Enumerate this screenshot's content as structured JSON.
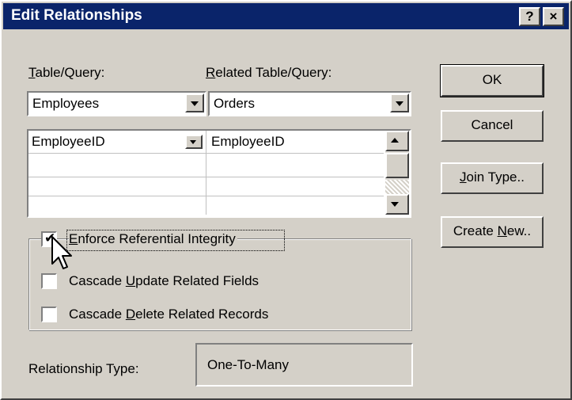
{
  "window": {
    "title": "Edit Relationships",
    "help_label": "?",
    "close_label": "×"
  },
  "tables": {
    "table_label_u": "T",
    "table_label_rest": "able/Query:",
    "related_label_u": "R",
    "related_label_rest": "elated Table/Query:",
    "table_value": "Employees",
    "related_value": "Orders"
  },
  "grid": {
    "rows": [
      {
        "left": "EmployeeID",
        "right": "EmployeeID"
      },
      {
        "left": "",
        "right": ""
      },
      {
        "left": "",
        "right": ""
      }
    ]
  },
  "buttons": {
    "ok": "OK",
    "cancel": "Cancel",
    "join_type_u": "J",
    "join_type_rest": "oin Type..",
    "create_new_pre": "Create ",
    "create_new_u": "N",
    "create_new_rest": "ew.."
  },
  "options": {
    "enforce_u": "E",
    "enforce_rest": "nforce Referential Integrity",
    "enforce_checked": true,
    "cascade_update_pre": "Cascade ",
    "cascade_update_u": "U",
    "cascade_update_rest": "pdate Related Fields",
    "cascade_update_checked": false,
    "cascade_delete_pre": "Cascade ",
    "cascade_delete_u": "D",
    "cascade_delete_rest": "elete Related Records",
    "cascade_delete_checked": false,
    "check_glyph": "✔"
  },
  "relationship": {
    "label": "Relationship Type:",
    "value": "One-To-Many"
  },
  "icons": {
    "help": "help-icon",
    "close": "close-icon",
    "dropdown": "chevron-down-icon",
    "scroll_up": "arrow-up-icon",
    "scroll_down": "arrow-down-icon",
    "cursor": "mouse-pointer-icon"
  },
  "colors": {
    "titlebar": "#0a246a",
    "face": "#d4d0c8"
  }
}
